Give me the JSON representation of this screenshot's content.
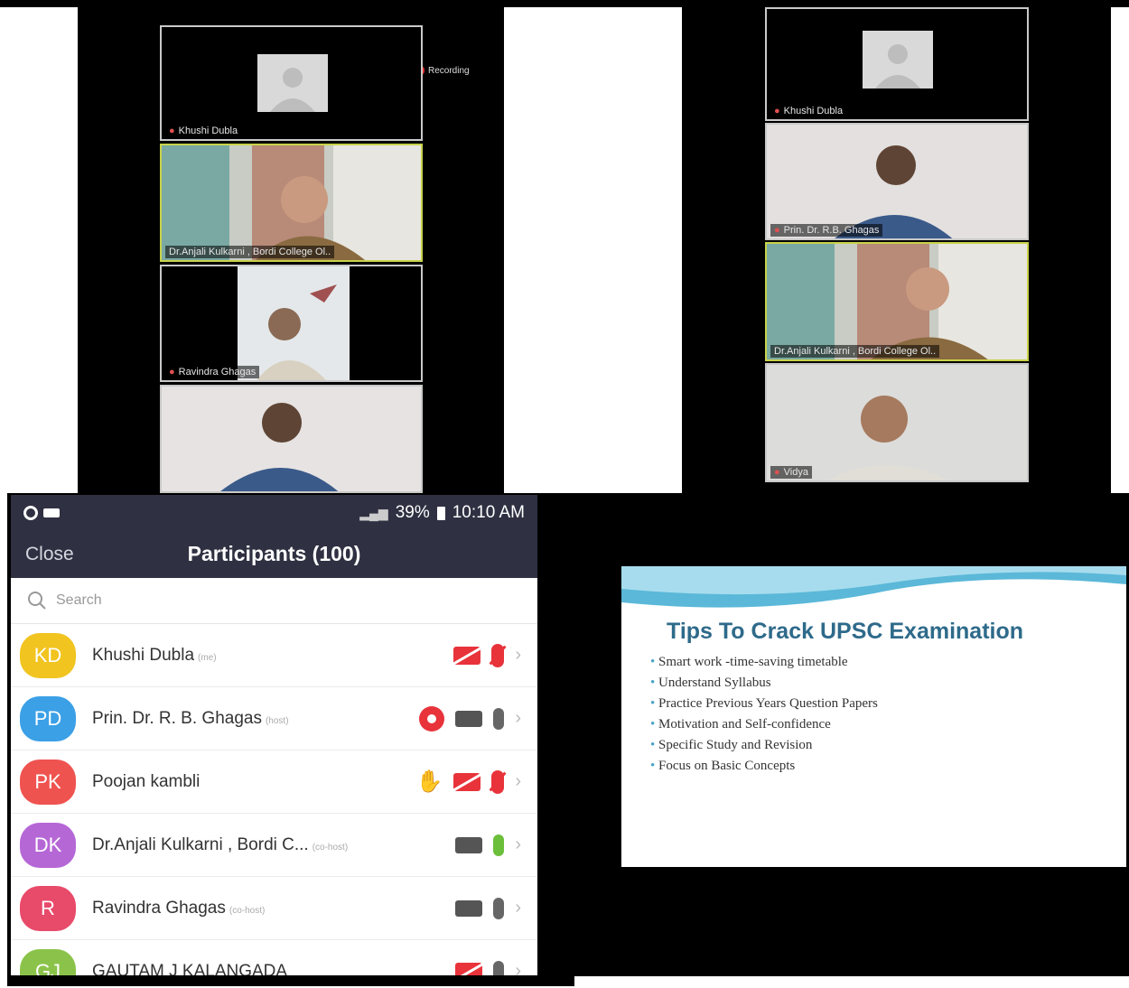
{
  "left_video": {
    "recording_label": "Recording",
    "tiles": [
      {
        "name": "Khushi Dubla",
        "type": "avatar"
      },
      {
        "name": "Dr.Anjali Kulkarni , Bordi College Ol..",
        "type": "video"
      },
      {
        "name": "Ravindra Ghagas",
        "type": "video"
      },
      {
        "name": "",
        "type": "video"
      }
    ]
  },
  "right_video": {
    "tiles": [
      {
        "name": "Khushi Dubla",
        "type": "avatar"
      },
      {
        "name": "Prin. Dr. R.B. Ghagas",
        "type": "video"
      },
      {
        "name": "Dr.Anjali Kulkarni , Bordi College Ol..",
        "type": "video"
      },
      {
        "name": "Vidya",
        "type": "video"
      }
    ]
  },
  "participants": {
    "status": {
      "battery": "39%",
      "time": "10:10 AM"
    },
    "close_label": "Close",
    "title": "Participants (100)",
    "search_placeholder": "Search",
    "list": [
      {
        "initials": "KD",
        "color": "#f1c41f",
        "name": "Khushi Dubla",
        "role": "(me)",
        "camera": "off",
        "mic": "off"
      },
      {
        "initials": "PD",
        "color": "#3ba0e6",
        "name": "Prin. Dr. R. B. Ghagas",
        "role": "(host)",
        "camera": "on",
        "mic": "on",
        "recording": true
      },
      {
        "initials": "PK",
        "color": "#ef5350",
        "name": "Poojan kambli",
        "role": "",
        "camera": "off",
        "mic": "off",
        "hand_raised": true
      },
      {
        "initials": "DK",
        "color": "#b667d6",
        "name": "Dr.Anjali Kulkarni , Bordi C...",
        "role": "(co-host)",
        "camera": "on",
        "mic": "active"
      },
      {
        "initials": "R",
        "color": "#e84a6a",
        "name": "Ravindra Ghagas",
        "role": "(co-host)",
        "camera": "on",
        "mic": "on"
      },
      {
        "initials": "GJ",
        "color": "#8bc34a",
        "name": "GAUTAM  J KALANGADA",
        "role": "",
        "camera": "off",
        "mic": "on"
      }
    ]
  },
  "slide": {
    "title": "Tips To Crack UPSC Examination",
    "bullets": [
      "Smart work -time-saving timetable",
      "Understand Syllabus",
      "Practice Previous Years Question Papers",
      "Motivation and Self-confidence",
      "Specific Study and Revision",
      "Focus on Basic Concepts"
    ]
  }
}
